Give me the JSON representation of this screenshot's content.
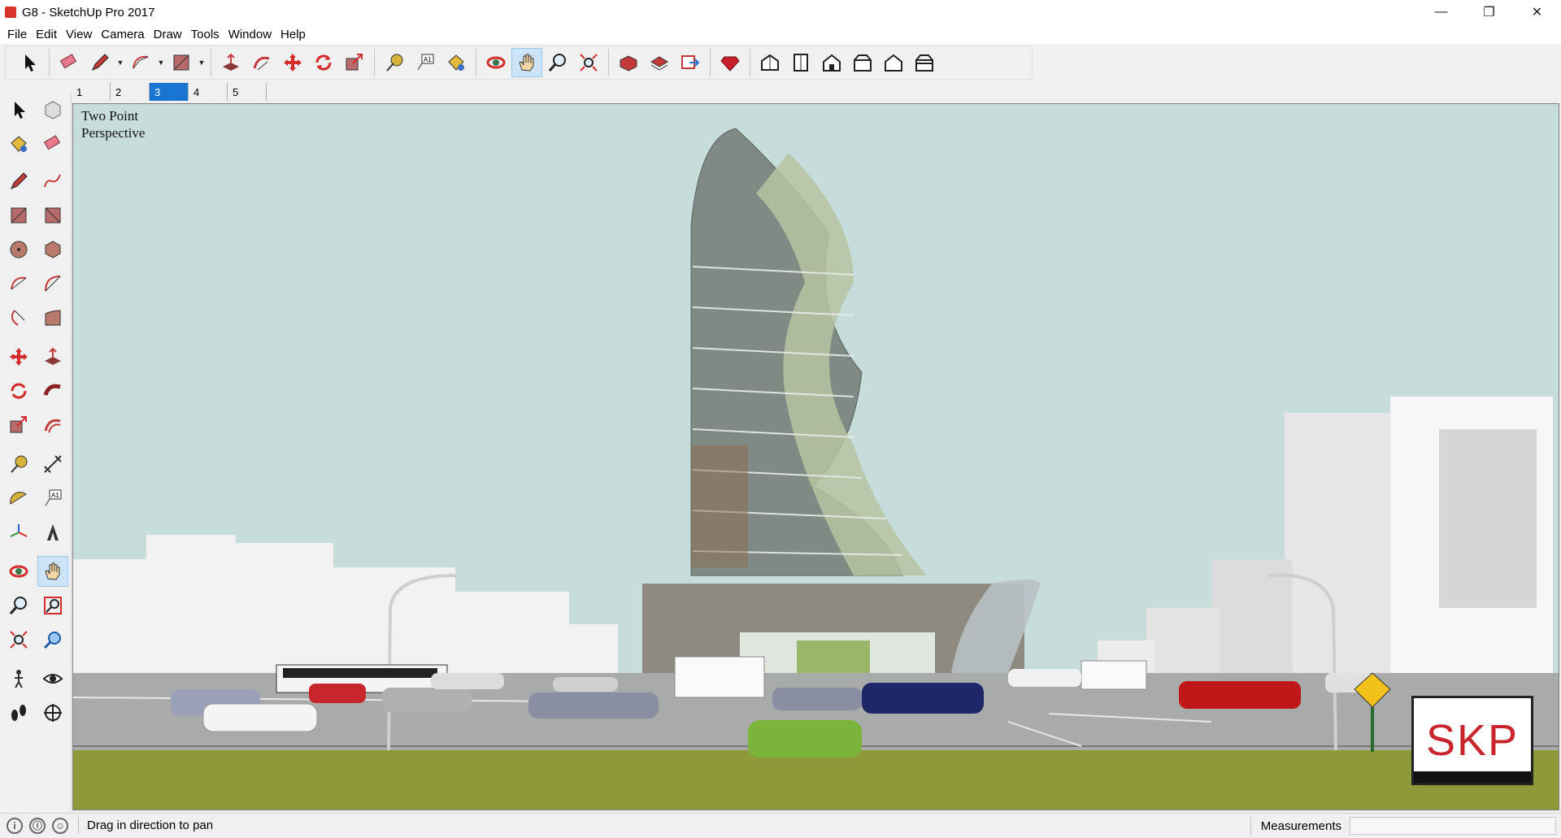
{
  "window": {
    "title": "G8 - SketchUp Pro 2017",
    "app_icon": "sketchup-icon"
  },
  "window_controls": [
    "minimize-icon",
    "restore-icon",
    "close-icon"
  ],
  "menu": [
    "File",
    "Edit",
    "View",
    "Camera",
    "Draw",
    "Tools",
    "Window",
    "Help"
  ],
  "toolbar": {
    "items": [
      "select-tool",
      "eraser-tool",
      "line-tool",
      "arc-tool",
      "rectangle-tool",
      "push-pull-tool",
      "offset-tool",
      "move-tool",
      "rotate-tool",
      "scale-tool",
      "tape-measure-tool",
      "text-tool",
      "paint-bucket-tool",
      "orbit-tool",
      "pan-tool",
      "zoom-tool",
      "zoom-extents-tool",
      "3d-warehouse",
      "extension-warehouse",
      "send-to-layout",
      "extension-manager",
      "iso-view",
      "top-view",
      "front-view",
      "right-view",
      "back-view",
      "left-view"
    ],
    "active": "pan-tool"
  },
  "scene_tabs": [
    {
      "label": "1",
      "active": false
    },
    {
      "label": "2",
      "active": false
    },
    {
      "label": "3",
      "active": true
    },
    {
      "label": "4",
      "active": false
    },
    {
      "label": "5",
      "active": false
    }
  ],
  "viewport": {
    "camera_label": "Two Point\nPerspective",
    "badge_text": "SKP",
    "sky_color": "#c7dddb",
    "ground_color": "#a9abab",
    "grass_color": "#8e9a3a"
  },
  "status": {
    "hint": "Drag in direction to pan",
    "measurements_label": "Measurements",
    "measurements_value": ""
  }
}
